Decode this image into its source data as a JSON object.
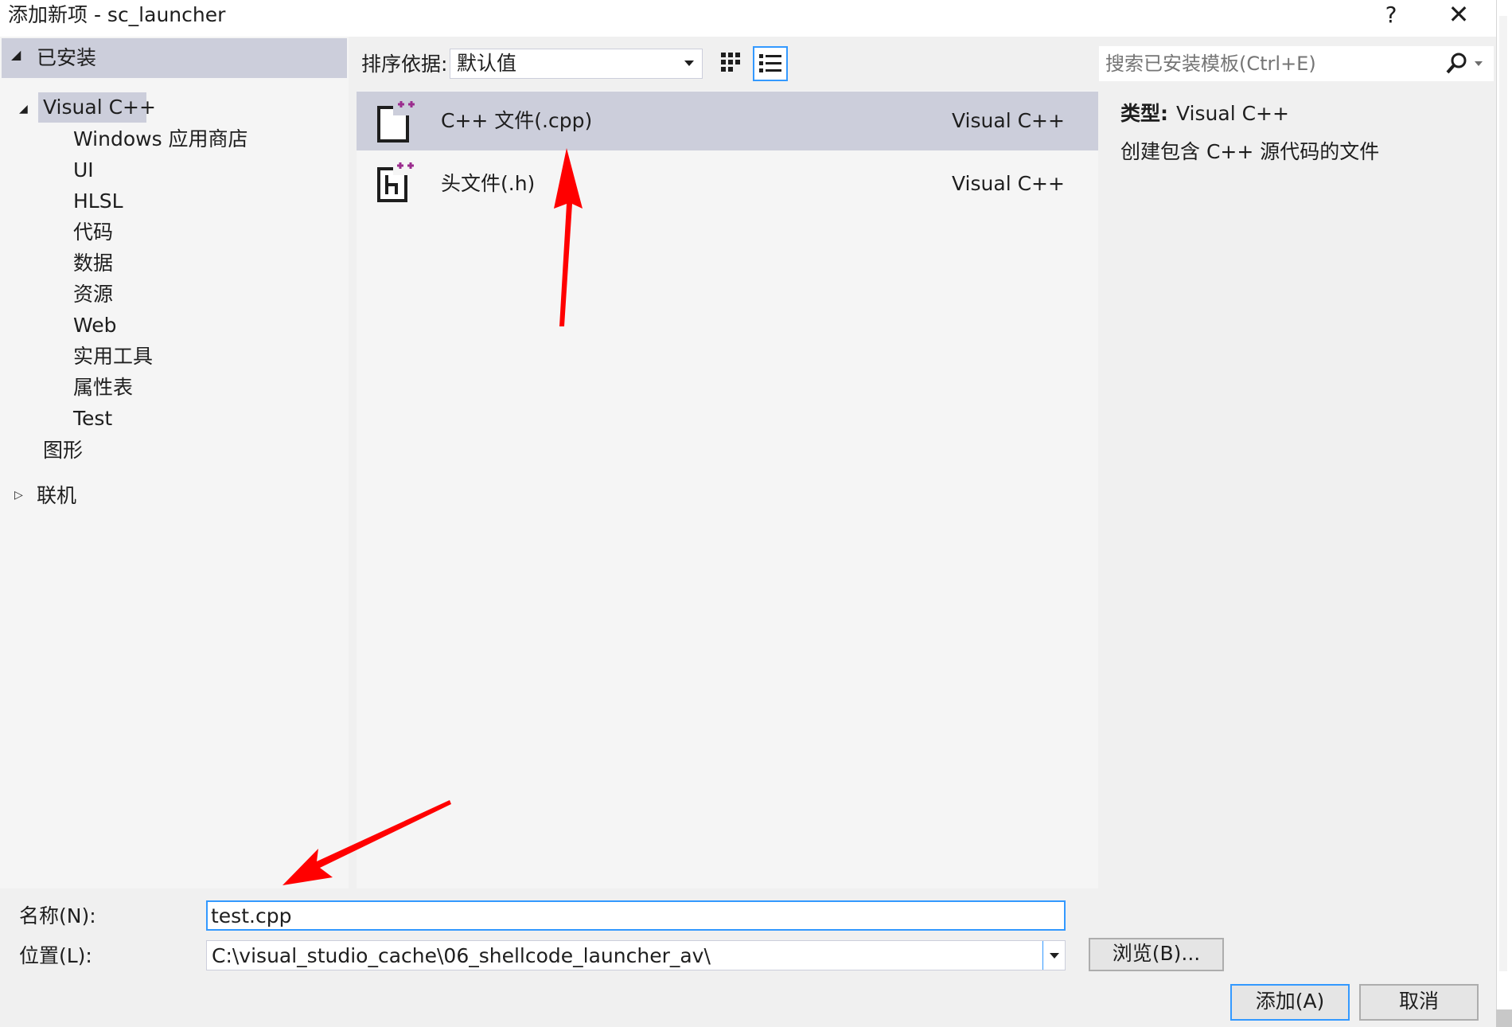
{
  "window": {
    "title": "添加新项 - sc_launcher",
    "help_label": "?",
    "close_label": "✕"
  },
  "tree": {
    "installed_label": "已安装",
    "root_label": "Visual C++",
    "children": [
      "Windows 应用商店",
      "UI",
      "HLSL",
      "代码",
      "数据",
      "资源",
      "Web",
      "实用工具",
      "属性表",
      "Test"
    ],
    "graphics_label": "图形",
    "online_label": "联机"
  },
  "toolbar": {
    "sort_label": "排序依据:",
    "sort_value": "默认值"
  },
  "templates": [
    {
      "name": "C++ 文件(.cpp)",
      "language": "Visual C++",
      "icon": "cpp-file-icon",
      "selected": true
    },
    {
      "name": "头文件(.h)",
      "language": "Visual C++",
      "icon": "header-file-icon",
      "selected": false
    }
  ],
  "search": {
    "placeholder": "搜索已安装模板(Ctrl+E)"
  },
  "details": {
    "type_label": "类型:",
    "type_value": "Visual C++",
    "description": "创建包含 C++ 源代码的文件"
  },
  "form": {
    "name_label": "名称(N):",
    "name_value": "test.cpp",
    "location_label": "位置(L):",
    "location_value": "C:\\visual_studio_cache\\06_shellcode_launcher_av\\",
    "browse_label": "浏览(B)...",
    "add_label": "添加(A)",
    "cancel_label": "取消"
  },
  "colors": {
    "selection": "#cccedb",
    "accent": "#3399ff",
    "icon_accent": "#9b2d8e",
    "annotation": "#ff0000"
  }
}
